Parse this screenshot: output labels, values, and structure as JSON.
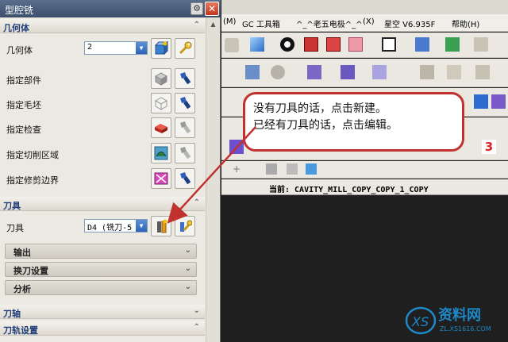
{
  "dialog": {
    "title": "型腔铣",
    "sections": {
      "geometry": {
        "title": "几何体"
      },
      "tool": {
        "title": "刀具"
      },
      "tool_axis": {
        "title": "刀轴"
      },
      "path_settings": {
        "title": "刀轨设置"
      }
    },
    "geometry_rows": {
      "geometry_label": "几何体",
      "geometry_value": "2",
      "specify_part": "指定部件",
      "specify_blank": "指定毛坯",
      "specify_check": "指定检查",
      "specify_cut_region": "指定切削区域",
      "specify_trim_boundary": "指定修剪边界"
    },
    "tool_rows": {
      "tool_label": "刀具",
      "tool_value": "D4 (铣刀-5"
    },
    "subsections": {
      "output": "输出",
      "tool_change": "换刀设置",
      "analysis": "分析"
    }
  },
  "menubar": {
    "items": [
      "(M)",
      "GC 工具箱",
      "^_^老五电极^_^",
      "(X)",
      "星空 V6.935F",
      "帮助(H)"
    ]
  },
  "statusbar": {
    "current": "当前: CAVITY_MILL_COPY_COPY_1_COPY"
  },
  "callout": {
    "line1": "没有刀具的话，点击新建。",
    "line2": "已经有刀具的话，点击编辑。"
  },
  "watermark": {
    "brand": "资料网",
    "url": "ZL.XS1616.COM"
  },
  "colors": {
    "accent_red": "#c0322f",
    "section_title": "#1f3d78",
    "title_bar": "#4a5e7c"
  }
}
